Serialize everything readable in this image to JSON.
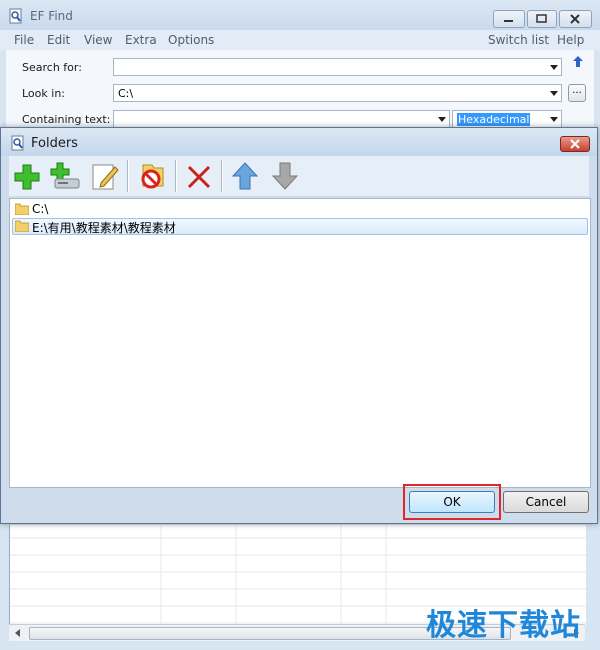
{
  "main_window": {
    "title": "EF Find",
    "menu": [
      "File",
      "Edit",
      "View",
      "Extra",
      "Options"
    ],
    "menu_right": [
      "Switch list",
      "Help"
    ],
    "search_for": {
      "label": "Search for:",
      "value": ""
    },
    "look_in": {
      "label": "Look in:",
      "value": "C:\\"
    },
    "containing_text": {
      "label": "Containing text:",
      "value": "",
      "mode": "Hexadecimal"
    },
    "browse_label": "..."
  },
  "folders_dialog": {
    "title": "Folders",
    "toolbar_icons": [
      "add-icon",
      "add-drive-icon",
      "edit-icon",
      "exclude-icon",
      "delete-icon",
      "move-up-icon",
      "move-down-icon"
    ],
    "folders": [
      {
        "path": "C:\\",
        "selected": false
      },
      {
        "path": "E:\\有用\\教程素材\\教程素材",
        "selected": true
      }
    ],
    "ok_label": "OK",
    "cancel_label": "Cancel"
  },
  "watermark": "极速下载站",
  "colors": {
    "highlight_box": "#e0262b",
    "selection": "#3399ff",
    "watermark": "#1f86d8"
  }
}
